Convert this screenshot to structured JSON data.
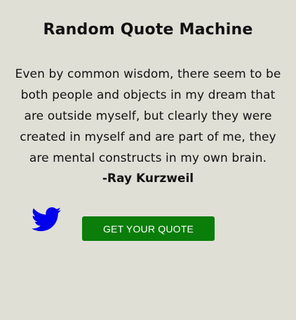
{
  "app": {
    "title": "Random Quote Machine"
  },
  "quote": {
    "text": "Even by common wisdom, there seem to be both people and objects in my dream that are outside myself, but clearly they were created in myself and are part of me, they are mental constructs in my own brain.",
    "author": "-Ray Kurzweil"
  },
  "actions": {
    "tweet_icon": "twitter-bird-icon",
    "get_quote_label": "GET YOUR QUOTE"
  },
  "colors": {
    "background": "#dfdfd6",
    "twitter_icon": "#0000ee",
    "button_bg": "#0a7d0a",
    "button_text": "#ffffff"
  }
}
